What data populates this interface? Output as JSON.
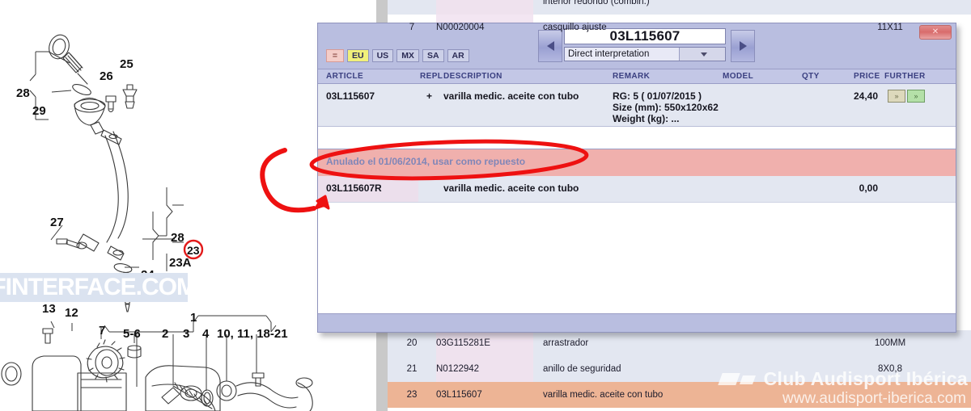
{
  "dialog": {
    "article_number": "03L115607",
    "interpretation": "Direct interpretation",
    "close_label": "✕",
    "nav_prev": "◀",
    "nav_next": "▶",
    "regions": [
      {
        "label": "=",
        "state": "equals"
      },
      {
        "label": "EU",
        "state": "selected"
      },
      {
        "label": "US",
        "state": "normal"
      },
      {
        "label": "MX",
        "state": "normal"
      },
      {
        "label": "SA",
        "state": "normal"
      },
      {
        "label": "AR",
        "state": "normal"
      }
    ],
    "columns": {
      "article": "ARTICLE",
      "repl": "REPL",
      "description": "DESCRIPTION",
      "remark": "REMARK",
      "model": "MODEL",
      "qty": "QTY",
      "price": "PRICE",
      "further": "FURTHER"
    },
    "main_row": {
      "article": "03L115607",
      "repl": "+",
      "description": "varilla medic. aceite con tubo",
      "remark_line1": "RG: 5 ( 01/07/2015 )",
      "remark_line2": "Size (mm): 550x120x62",
      "remark_line3": "Weight (kg): ...",
      "model": "",
      "qty": "",
      "price": "24,40",
      "further_btn1": "»",
      "further_btn2": "»"
    },
    "notice_row": {
      "text": "Anulado el 01/06/2014, usar como repuesto"
    },
    "replacement_row": {
      "article": "03L115607R",
      "repl": "",
      "description": "varilla medic. aceite con tubo",
      "price": "0,00"
    }
  },
  "background_table": {
    "rows": [
      {
        "pos": "",
        "article": "",
        "description": "interior redondo (combin.)",
        "remark": "",
        "style": "alt"
      },
      {
        "pos": "7",
        "article": "N00020004",
        "description": "casquillo ajuste",
        "remark": "11X11",
        "style": "white"
      },
      {
        "pos": "20",
        "article": "03G115281E",
        "description": "arrastrador",
        "remark": "100MM",
        "style": "alt"
      },
      {
        "pos": "21",
        "article": "N0122942",
        "description": "anillo de seguridad",
        "remark": "8X0,8",
        "style": "alt"
      },
      {
        "pos": "23",
        "article": "03L115607",
        "description": "varilla medic. aceite con tubo",
        "remark": "",
        "style": "hl"
      }
    ]
  },
  "watermarks": {
    "diagram": "IFINTERFACE.COM",
    "brand": "Club Audisport Ibérica",
    "url": "www.audisport-iberica.com"
  },
  "diagram": {
    "callouts": [
      "28",
      "29",
      "26",
      "25",
      "27",
      "28",
      "23A",
      "23",
      "24",
      "13",
      "12",
      "7",
      "1",
      "5-6",
      "2",
      "3",
      "4",
      "10, 11, 18-21"
    ]
  }
}
